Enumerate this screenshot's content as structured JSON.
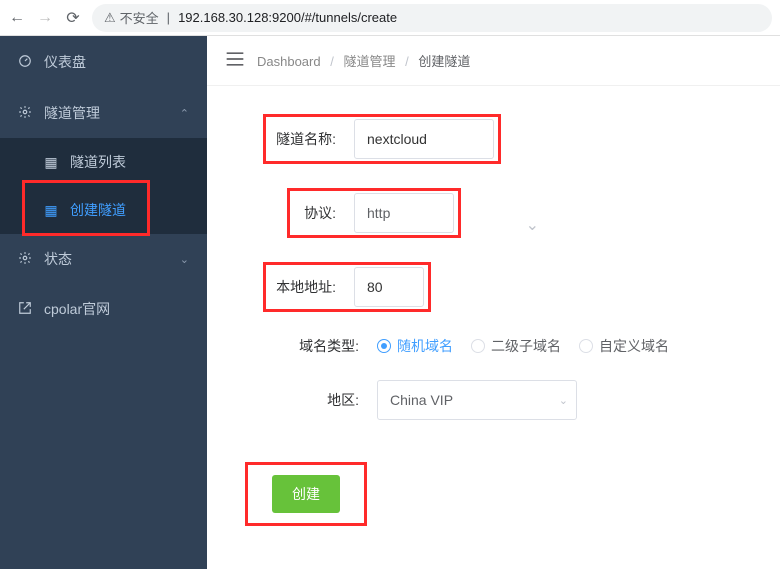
{
  "browser": {
    "insecure_label": "不安全",
    "url_display": "192.168.30.128:9200/#/tunnels/create"
  },
  "sidebar": {
    "items": [
      {
        "label": "仪表盘"
      },
      {
        "label": "隧道管理"
      },
      {
        "label": "隧道列表"
      },
      {
        "label": "创建隧道"
      },
      {
        "label": "状态"
      },
      {
        "label": "cpolar官网"
      }
    ]
  },
  "breadcrumb": {
    "root": "Dashboard",
    "mid": "隧道管理",
    "leaf": "创建隧道"
  },
  "form": {
    "tunnel_name_label": "隧道名称:",
    "tunnel_name_value": "nextcloud",
    "protocol_label": "协议:",
    "protocol_value": "http",
    "local_addr_label": "本地地址:",
    "local_addr_value": "80",
    "domain_type_label": "域名类型:",
    "domain_opt_random": "随机域名",
    "domain_opt_sub": "二级子域名",
    "domain_opt_custom": "自定义域名",
    "region_label": "地区:",
    "region_value": "China VIP",
    "submit_label": "创建"
  }
}
